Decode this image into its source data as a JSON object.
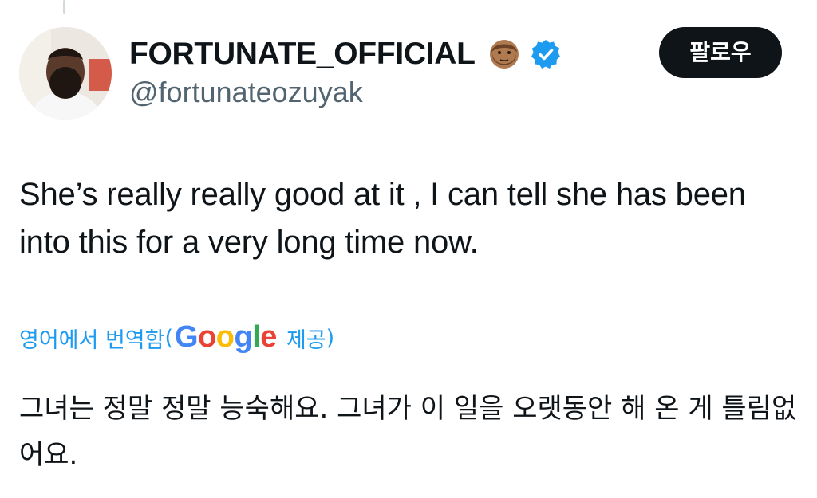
{
  "author": {
    "display_name": "FORTUNATE_OFFICIAL",
    "handle": "@fortunateozuyak",
    "emoji_icon": "bearded-man-emoji",
    "verified_icon": "verified-badge-icon",
    "verified_color": "#1d9bf0"
  },
  "follow_button": {
    "label": "팔로우"
  },
  "tweet": {
    "text": "She’s really really good at it , I can tell she has been into this for a very long time now."
  },
  "translation": {
    "label": "영어에서 번역함",
    "open_paren": "(",
    "provider_logo": "Google",
    "provided_label": "제공",
    "close_paren": ")",
    "text": "그녀는 정말 정말 능숙해요. 그녀가 이 일을 오랫동안 해 온 게 틀림없어요."
  },
  "colors": {
    "link_blue": "#1d9bf0",
    "secondary_text": "#536471",
    "button_dark": "#0f1419"
  }
}
